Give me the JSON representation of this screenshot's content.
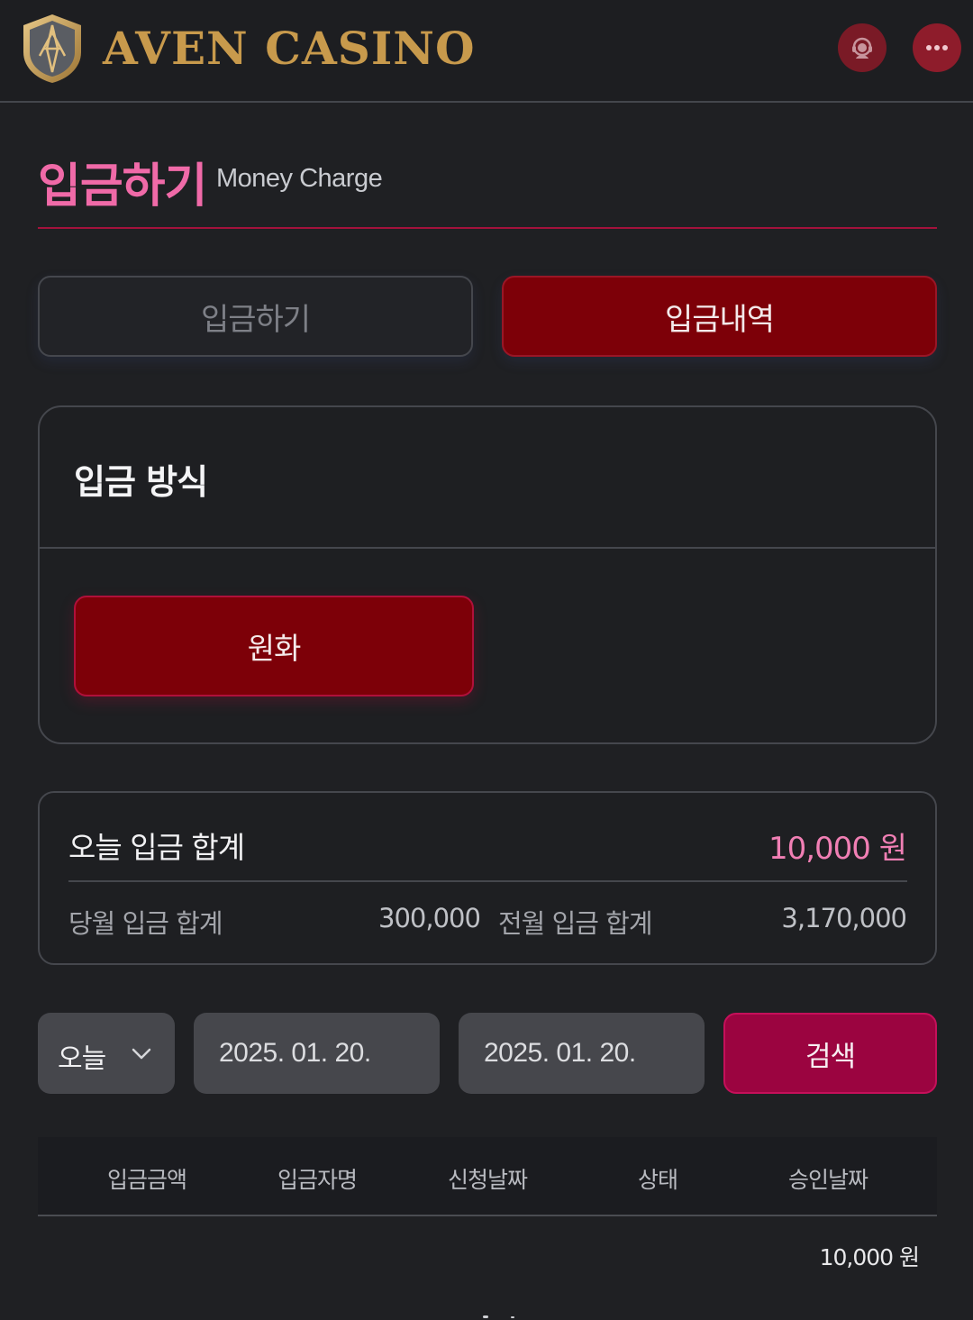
{
  "header": {
    "brand": "AVEN CASINO",
    "support_icon": "headset-agent-icon",
    "chat_icon": "chat-bubble-icon",
    "brand_color": "#c89a4c"
  },
  "title": {
    "korean": "입금하기",
    "english": "Money Charge"
  },
  "tabs": [
    {
      "label": "입금하기",
      "active": false
    },
    {
      "label": "입금내역",
      "active": true
    }
  ],
  "method": {
    "title": "입금 방식",
    "options": [
      {
        "label": "원화",
        "selected": true
      }
    ]
  },
  "totals": {
    "today_label": "오늘 입금 합계",
    "today_value": "10,000 원",
    "month_label": "당월 입금 합계",
    "month_value": "300,000",
    "prev_label": "전월 입금 합계",
    "prev_value": "3,170,000"
  },
  "filter": {
    "period": "오늘",
    "from_date": "2025. 01. 20.",
    "to_date": "2025. 01. 20.",
    "search_label": "검색"
  },
  "table": {
    "columns": [
      "입금금액",
      "입금자명",
      "신청날짜",
      "상태",
      "승인날짜"
    ],
    "rows": [
      {
        "amount": "10,000 원"
      }
    ]
  },
  "colors": {
    "accent_pink": "#f06aa8",
    "active_red": "#7d0008",
    "search_red": "#9b0440"
  }
}
